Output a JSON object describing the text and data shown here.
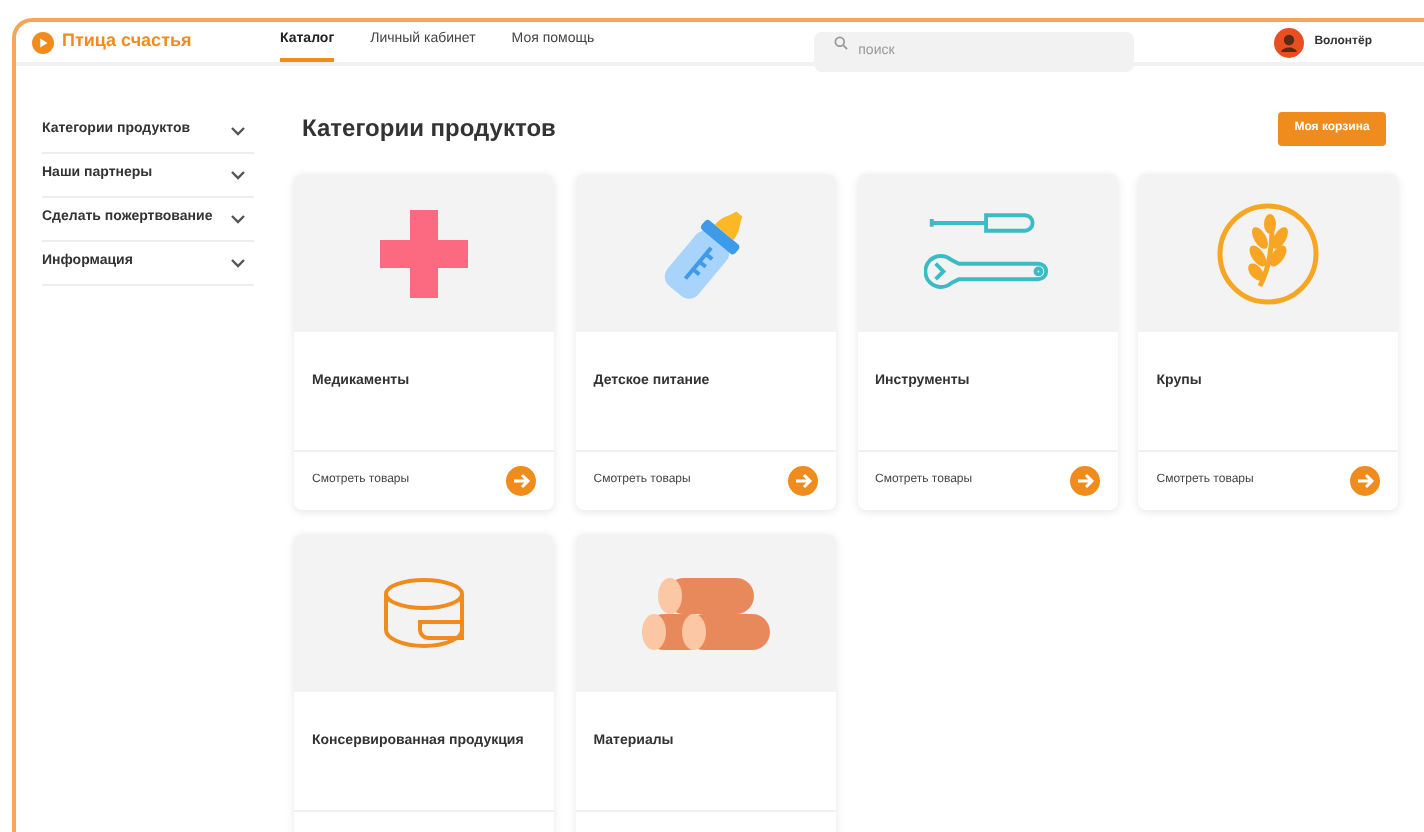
{
  "header": {
    "logo": "Птица счастья",
    "nav": [
      {
        "label": "Каталог",
        "selected": true
      },
      {
        "label": "Личный кабинет",
        "selected": false
      },
      {
        "label": "Моя помощь",
        "selected": false
      }
    ],
    "search": {
      "placeholder": "поиск"
    },
    "user": "Волонтёр"
  },
  "sidebar": {
    "items": [
      {
        "label": "Категории продуктов",
        "expanded": false
      },
      {
        "label": "Наши партнеры",
        "expanded": false
      },
      {
        "label": "Сделать пожертвование",
        "expanded": false
      },
      {
        "label": "Информация",
        "expanded": false
      }
    ]
  },
  "main": {
    "title": "Категории продуктов",
    "cart_button": "Моя корзина",
    "cards": [
      {
        "title": "Медикаменты",
        "link": "Смотреть товары"
      },
      {
        "title": "Детское питание",
        "link": "Смотреть товары"
      },
      {
        "title": "Инструменты",
        "link": "Смотреть товары"
      },
      {
        "title": "Крупы",
        "link": "Смотреть товары"
      },
      {
        "title": "Консервированная продукция"
      },
      {
        "title": "Материалы"
      }
    ]
  }
}
